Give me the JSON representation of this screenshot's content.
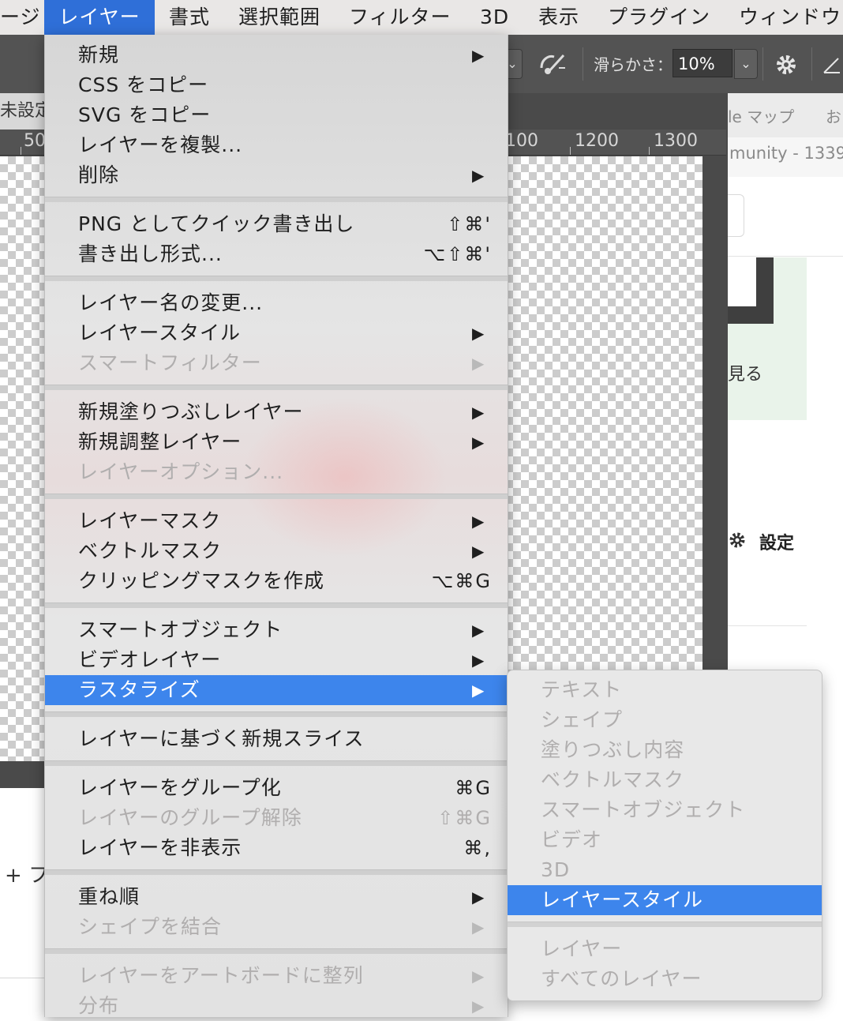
{
  "menubar": {
    "items": [
      "ージ",
      "レイヤー",
      "書式",
      "選択範囲",
      "フィルター",
      "3D",
      "表示",
      "プラグイン",
      "ウィンドウ"
    ],
    "active": "レイヤー"
  },
  "options_bar": {
    "smoothing_label": "滑らかさ：",
    "smoothing_value": "10%",
    "dropdown_glyph": "⌄"
  },
  "document": {
    "tab_label": "未設定",
    "ruler_labels": [
      "50",
      "100",
      "1200",
      "1300"
    ]
  },
  "web_fragment": {
    "tab_a": "le マップ",
    "tab_b": "お",
    "url_text": "munity - 1339",
    "see_text": "見る",
    "settings_label": "設定",
    "add_text": "+ フ"
  },
  "layer_menu": {
    "groups": [
      [
        {
          "label": "新規",
          "submenu": true
        },
        {
          "label": "CSS をコピー"
        },
        {
          "label": "SVG をコピー"
        },
        {
          "label": "レイヤーを複製..."
        },
        {
          "label": "削除",
          "submenu": true
        }
      ],
      [
        {
          "label": "PNG としてクイック書き出し",
          "shortcut": "⇧⌘'"
        },
        {
          "label": "書き出し形式...",
          "shortcut": "⌥⇧⌘'"
        }
      ],
      [
        {
          "label": "レイヤー名の変更..."
        },
        {
          "label": "レイヤースタイル",
          "submenu": true
        },
        {
          "label": "スマートフィルター",
          "submenu": true,
          "disabled": true
        }
      ],
      [
        {
          "label": "新規塗りつぶしレイヤー",
          "submenu": true
        },
        {
          "label": "新規調整レイヤー",
          "submenu": true
        },
        {
          "label": "レイヤーオプション...",
          "disabled": true
        }
      ],
      [
        {
          "label": "レイヤーマスク",
          "submenu": true
        },
        {
          "label": "ベクトルマスク",
          "submenu": true
        },
        {
          "label": "クリッピングマスクを作成",
          "shortcut": "⌥⌘G"
        }
      ],
      [
        {
          "label": "スマートオブジェクト",
          "submenu": true
        },
        {
          "label": "ビデオレイヤー",
          "submenu": true
        },
        {
          "label": "ラスタライズ",
          "submenu": true,
          "selected": true
        }
      ],
      [
        {
          "label": "レイヤーに基づく新規スライス"
        }
      ],
      [
        {
          "label": "レイヤーをグループ化",
          "shortcut": "⌘G"
        },
        {
          "label": "レイヤーのグループ解除",
          "shortcut": "⇧⌘G",
          "disabled": true
        },
        {
          "label": "レイヤーを非表示",
          "shortcut": "⌘,"
        }
      ],
      [
        {
          "label": "重ね順",
          "submenu": true
        },
        {
          "label": "シェイプを結合",
          "submenu": true,
          "disabled": true
        }
      ],
      [
        {
          "label": "レイヤーをアートボードに整列",
          "submenu": true,
          "disabled": true
        },
        {
          "label": "分布",
          "submenu": true,
          "disabled": true
        }
      ]
    ],
    "submenu_arrow": "▶"
  },
  "rasterize_submenu": {
    "groups": [
      [
        {
          "label": "テキスト",
          "disabled": true
        },
        {
          "label": "シェイプ",
          "disabled": true
        },
        {
          "label": "塗りつぶし内容",
          "disabled": true
        },
        {
          "label": "ベクトルマスク",
          "disabled": true
        },
        {
          "label": "スマートオブジェクト",
          "disabled": true
        },
        {
          "label": "ビデオ",
          "disabled": true
        },
        {
          "label": "3D",
          "disabled": true
        },
        {
          "label": "レイヤースタイル",
          "selected": true
        }
      ],
      [
        {
          "label": "レイヤー",
          "disabled": true
        },
        {
          "label": "すべてのレイヤー",
          "disabled": true
        }
      ]
    ]
  },
  "colors": {
    "menu_highlight": "#3d85ec",
    "menubar_active": "#2f6fd8",
    "disabled_text": "#b0aeae"
  }
}
